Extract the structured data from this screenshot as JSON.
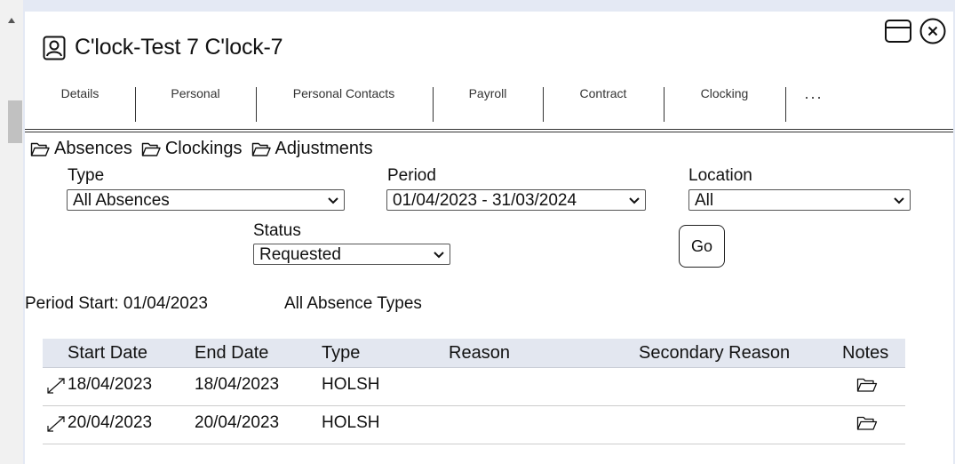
{
  "title": "C'lock-Test 7 C'lock-7",
  "tabs": [
    "Details",
    "Personal",
    "Personal Contacts",
    "Payroll",
    "Contract",
    "Clocking",
    "..."
  ],
  "folders": [
    "Absences",
    "Clockings",
    "Adjustments"
  ],
  "filters": {
    "type_label": "Type",
    "type_value": "All Absences",
    "period_label": "Period",
    "period_value": "01/04/2023 - 31/03/2024",
    "location_label": "Location",
    "location_value": "All",
    "status_label": "Status",
    "status_value": "Requested",
    "go_label": "Go"
  },
  "info": {
    "period_start": "Period Start: 01/04/2023",
    "absence_types": "All Absence Types"
  },
  "table": {
    "headers": [
      "Start Date",
      "End Date",
      "Type",
      "Reason",
      "Secondary Reason",
      "Notes"
    ],
    "rows": [
      {
        "start": "18/04/2023",
        "end": "18/04/2023",
        "type": "HOLSH",
        "reason": "",
        "secondary": ""
      },
      {
        "start": "20/04/2023",
        "end": "20/04/2023",
        "type": "HOLSH",
        "reason": "",
        "secondary": ""
      }
    ]
  }
}
